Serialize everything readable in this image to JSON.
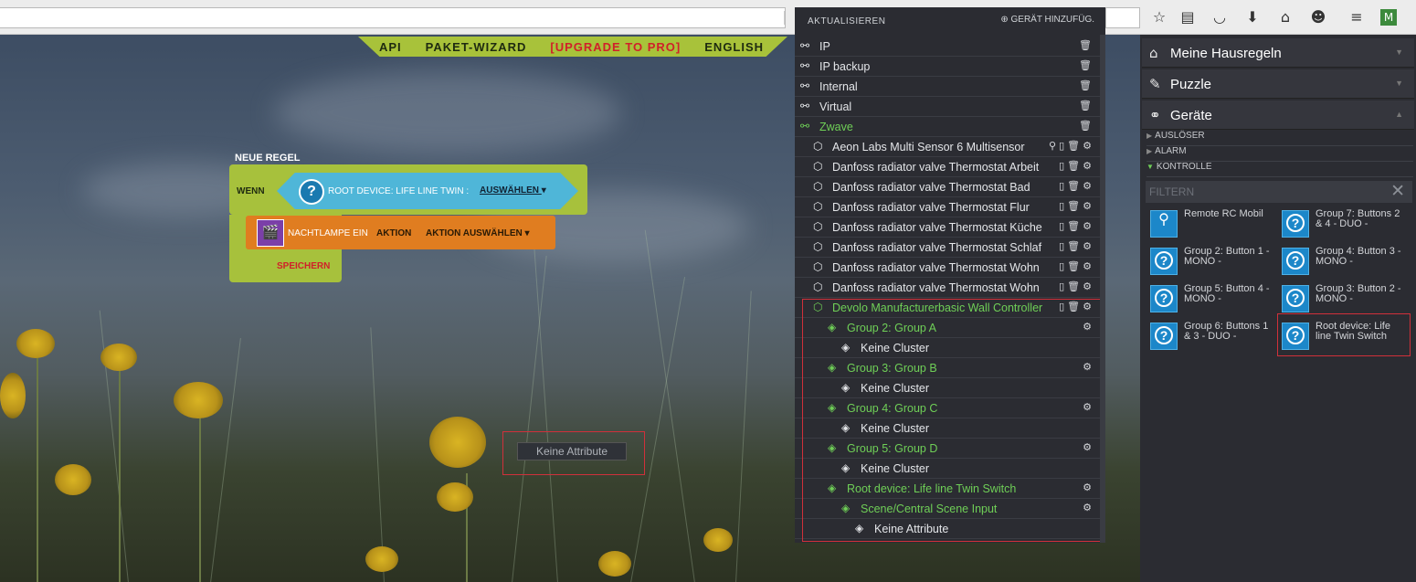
{
  "browser": {
    "icons": [
      "star-icon",
      "reading-list-icon",
      "pocket-icon",
      "download-icon",
      "home-icon",
      "chat-icon",
      "menu-icon",
      "extension-icon"
    ]
  },
  "topnav": {
    "items": [
      "API",
      "PAKET-WIZARD",
      "[UPGRADE TO PRO]",
      "ENGLISH"
    ]
  },
  "rule": {
    "title": "NEUE REGEL",
    "wenn_label": "WENN",
    "trigger_text": "ROOT DEVICE: LIFE LINE TWIN :",
    "trigger_select": "AUSWÄHLEN",
    "action_name": "NACHTLAMPE EIN",
    "action_label": "AKTION",
    "action_select": "AKTION AUSWÄHLEN",
    "save_label": "SPEICHERN"
  },
  "tooltip": {
    "text": "Keine Attribute"
  },
  "tree": {
    "header_left": "AKTUALISIEREN",
    "header_right": "GERÄT HINZUFÜG.",
    "rows": [
      {
        "label": "IP"
      },
      {
        "label": "IP backup"
      },
      {
        "label": "Internal"
      },
      {
        "label": "Virtual"
      },
      {
        "label": "Zwave"
      },
      {
        "label": "Aeon Labs Multi Sensor 6 Multisensor"
      },
      {
        "label": "Danfoss radiator valve Thermostat Arbeit"
      },
      {
        "label": "Danfoss radiator valve Thermostat Bad"
      },
      {
        "label": "Danfoss radiator valve Thermostat Flur"
      },
      {
        "label": "Danfoss radiator valve Thermostat Küche"
      },
      {
        "label": "Danfoss radiator valve Thermostat Schlaf"
      },
      {
        "label": "Danfoss radiator valve Thermostat Wohn"
      },
      {
        "label": "Danfoss radiator valve Thermostat Wohn"
      },
      {
        "label": "Devolo Manufacturerbasic Wall Controller"
      },
      {
        "label": "Group 2: Group A"
      },
      {
        "label": "Keine Cluster"
      },
      {
        "label": "Group 3: Group B"
      },
      {
        "label": "Keine Cluster"
      },
      {
        "label": "Group 4: Group C"
      },
      {
        "label": "Keine Cluster"
      },
      {
        "label": "Group 5: Group D"
      },
      {
        "label": "Keine Cluster"
      },
      {
        "label": "Root device: Life line Twin Switch"
      },
      {
        "label": "Scene/Central Scene Input"
      },
      {
        "label": "Keine Attribute"
      }
    ]
  },
  "sidebar": {
    "sections": [
      "Meine Hausregeln",
      "Puzzle",
      "Geräte"
    ],
    "subcategories": [
      "AUSLÖSER",
      "ALARM",
      "KONTROLLE"
    ],
    "filter_placeholder": "FILTERN",
    "devices": [
      "Remote RC Mobil",
      "Group 7: Buttons 2 & 4 - DUO -",
      "Group 2: Button 1 - MONO -",
      "Group 4: Button 3 - MONO -",
      "Group 5: Button 4 - MONO -",
      "Group 3: Button 2 - MONO -",
      "Group 6: Buttons 1 & 3 - DUO -",
      "Root device: Life line Twin Switch"
    ]
  },
  "colors": {
    "accent_green": "#6fcf57",
    "block_green": "#a7c13c",
    "trigger_blue": "#4fb6d8",
    "action_orange": "#e07d20",
    "highlight_red": "#d0303a"
  }
}
